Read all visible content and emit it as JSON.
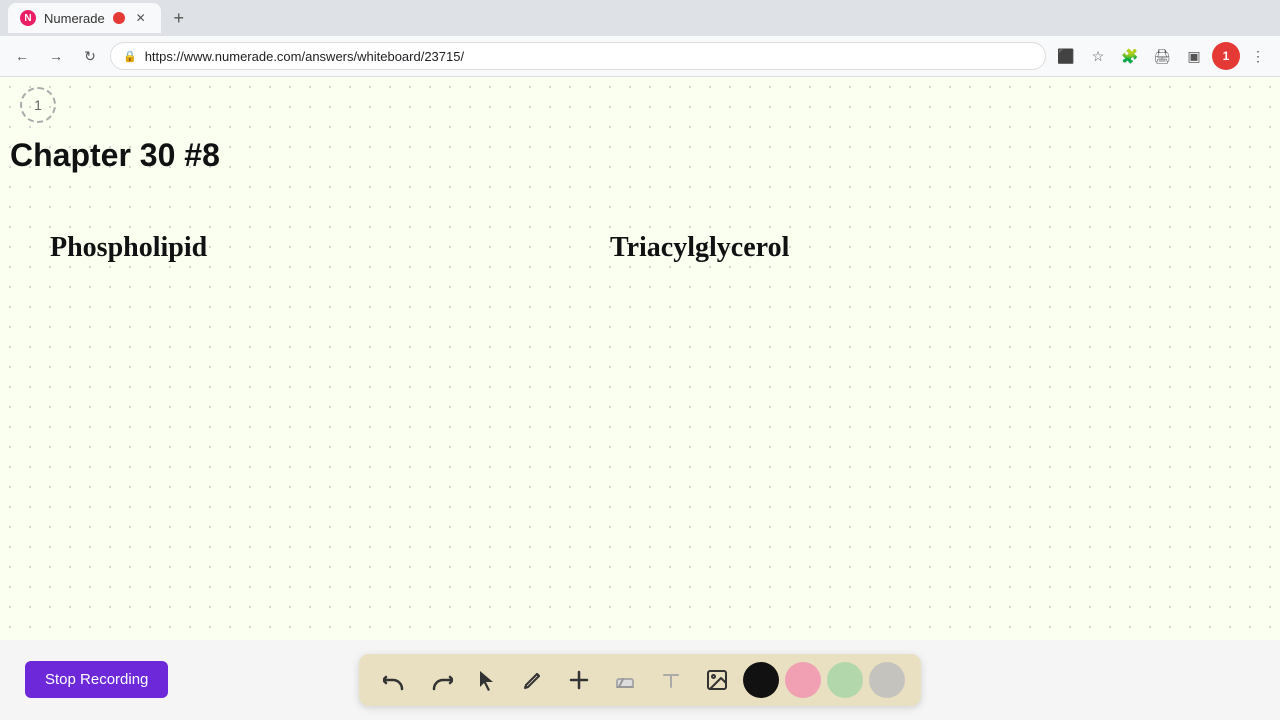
{
  "browser": {
    "tab_title": "Numerade",
    "tab_favicon_label": "N",
    "url": "https://www.numerade.com/answers/whiteboard/23715/",
    "new_tab_label": "+"
  },
  "whiteboard": {
    "page_number": "1",
    "chapter_title": "Chapter 30 #8",
    "text_phospholipid": "Phospholipid",
    "text_triacylglycerol": "Triacylglycerol"
  },
  "toolbar": {
    "undo_label": "↩",
    "redo_label": "↪",
    "cursor_label": "▲",
    "pen_label": "✎",
    "add_label": "+",
    "eraser_label": "⌫",
    "text_label": "A",
    "image_label": "🖼",
    "colors": [
      "#111111",
      "#f48fb1",
      "#a5d6a7",
      "#bdbdbd"
    ]
  },
  "stop_recording": {
    "label": "Stop Recording"
  }
}
